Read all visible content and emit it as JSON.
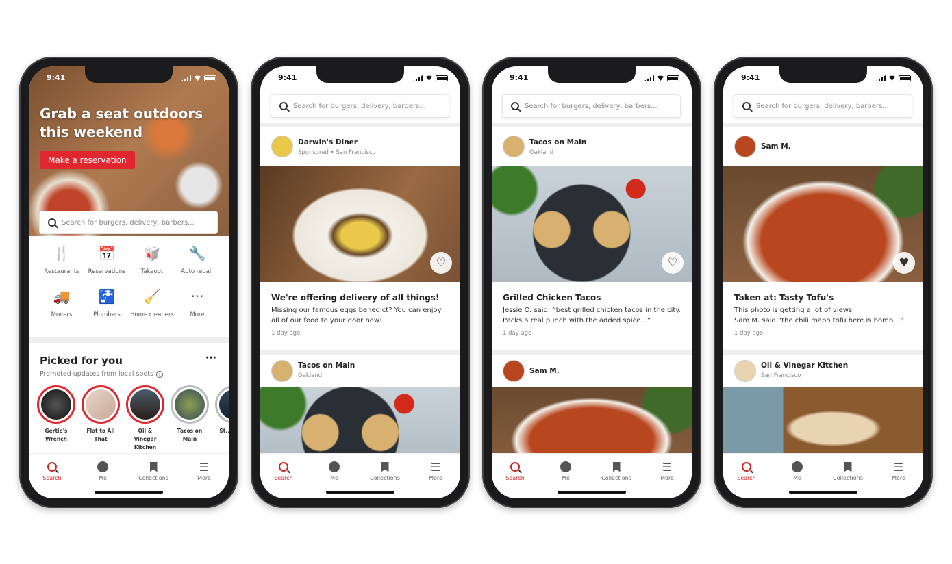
{
  "status_time": "9:41",
  "search_placeholder": "Search for burgers, delivery, barbers...",
  "accent_color": "#d32323",
  "tabs": [
    {
      "label": "Search",
      "icon": "search-icon",
      "active": true
    },
    {
      "label": "Me",
      "icon": "profile-icon",
      "active": false
    },
    {
      "label": "Collections",
      "icon": "bookmark-icon",
      "active": false
    },
    {
      "label": "More",
      "icon": "menu-icon",
      "active": false
    }
  ],
  "home": {
    "hero_title": "Grab a seat outdoors this weekend",
    "hero_button": "Make a reservation",
    "categories": [
      {
        "label": "Restaurants",
        "icon": "utensils-icon"
      },
      {
        "label": "Reservations",
        "icon": "calendar-icon"
      },
      {
        "label": "Takeout",
        "icon": "takeout-icon"
      },
      {
        "label": "Auto repair",
        "icon": "wrench-icon"
      },
      {
        "label": "Movers",
        "icon": "truck-icon"
      },
      {
        "label": "Plumbers",
        "icon": "faucet-icon"
      },
      {
        "label": "Home cleaners",
        "icon": "broom-icon"
      },
      {
        "label": "More",
        "icon": "more-icon"
      }
    ],
    "picked_title": "Picked for you",
    "picked_subtitle": "Promoted updates from local spots",
    "stories": [
      {
        "name": "Gertie's Wrench",
        "seen": false
      },
      {
        "name": "Flat to All That",
        "seen": false
      },
      {
        "name": "Oil & Vinegar Kitchen",
        "seen": false
      },
      {
        "name": "Tacos on Main",
        "seen": true
      },
      {
        "name": "St... Bra...",
        "seen": true
      }
    ]
  },
  "feeds": [
    {
      "cards": [
        {
          "name": "Darwin's Diner",
          "subtitle": "Sponsored • San Francisco",
          "title": "We're offering delivery of all things!",
          "body": "Missing our famous eggs benedict? You can enjoy all of our food to your door now!",
          "time": "1 day ago",
          "liked": false,
          "photo": "eggs"
        },
        {
          "name": "Tacos on Main",
          "subtitle": "Oakland",
          "photo": "tacos"
        }
      ]
    },
    {
      "cards": [
        {
          "name": "Tacos on Main",
          "subtitle": "Oakland",
          "title": "Grilled Chicken Tacos",
          "body": "Jessie O. said: “best grilled chicken tacos in the city. Packs a real punch with the added spice...”",
          "time": "1 day ago",
          "liked": false,
          "photo": "tacos"
        },
        {
          "name": "Sam M.",
          "subtitle": "",
          "photo": "tofu"
        }
      ]
    },
    {
      "cards": [
        {
          "name": "Sam M.",
          "subtitle": "",
          "title": "Taken at: Tasty Tofu's",
          "body": "This photo is getting a lot of views\nSam M. said “the chili mapo tofu here is bomb...”",
          "time": "1 day ago",
          "liked": true,
          "photo": "tofu"
        },
        {
          "name": "Oil & Vinegar Kitchen",
          "subtitle": "San Francisco",
          "photo": "sandwich"
        }
      ]
    }
  ]
}
